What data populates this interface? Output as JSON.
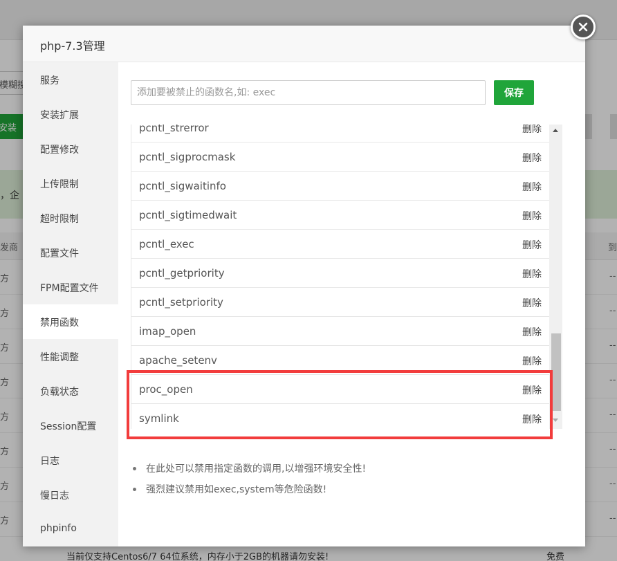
{
  "background": {
    "search_partial": "模糊搜",
    "install_partial": "安装",
    "notice_partial": "，企",
    "header_left_partial": "发商",
    "header_right_partial": "到",
    "row_left_partial": "方",
    "row_right_partial": "--",
    "footer_text": "当前仅支持Centos6/7 64位系统，内存小于2GB的机器请勿安装!",
    "footer_fee": "免费"
  },
  "modal": {
    "title": "php-7.3管理"
  },
  "sidebar": {
    "items": [
      {
        "label": "服务"
      },
      {
        "label": "安装扩展"
      },
      {
        "label": "配置修改"
      },
      {
        "label": "上传限制"
      },
      {
        "label": "超时限制"
      },
      {
        "label": "配置文件"
      },
      {
        "label": "FPM配置文件"
      },
      {
        "label": "禁用函数",
        "active": true
      },
      {
        "label": "性能调整"
      },
      {
        "label": "负载状态"
      },
      {
        "label": "Session配置"
      },
      {
        "label": "日志"
      },
      {
        "label": "慢日志"
      },
      {
        "label": "phpinfo"
      }
    ]
  },
  "content": {
    "input_placeholder": "添加要被禁止的函数名,如: exec",
    "save_label": "保存",
    "delete_label": "删除",
    "functions": [
      "pcntl_strerror",
      "pcntl_sigprocmask",
      "pcntl_sigwaitinfo",
      "pcntl_sigtimedwait",
      "pcntl_exec",
      "pcntl_getpriority",
      "pcntl_setpriority",
      "imap_open",
      "apache_setenv",
      "proc_open",
      "symlink"
    ],
    "tips": [
      "在此处可以禁用指定函数的调用,以增强环境安全性!",
      "强烈建议禁用如exec,system等危险函数!"
    ]
  },
  "colors": {
    "accent": "#20a53a",
    "highlight": "#f23c3c"
  }
}
